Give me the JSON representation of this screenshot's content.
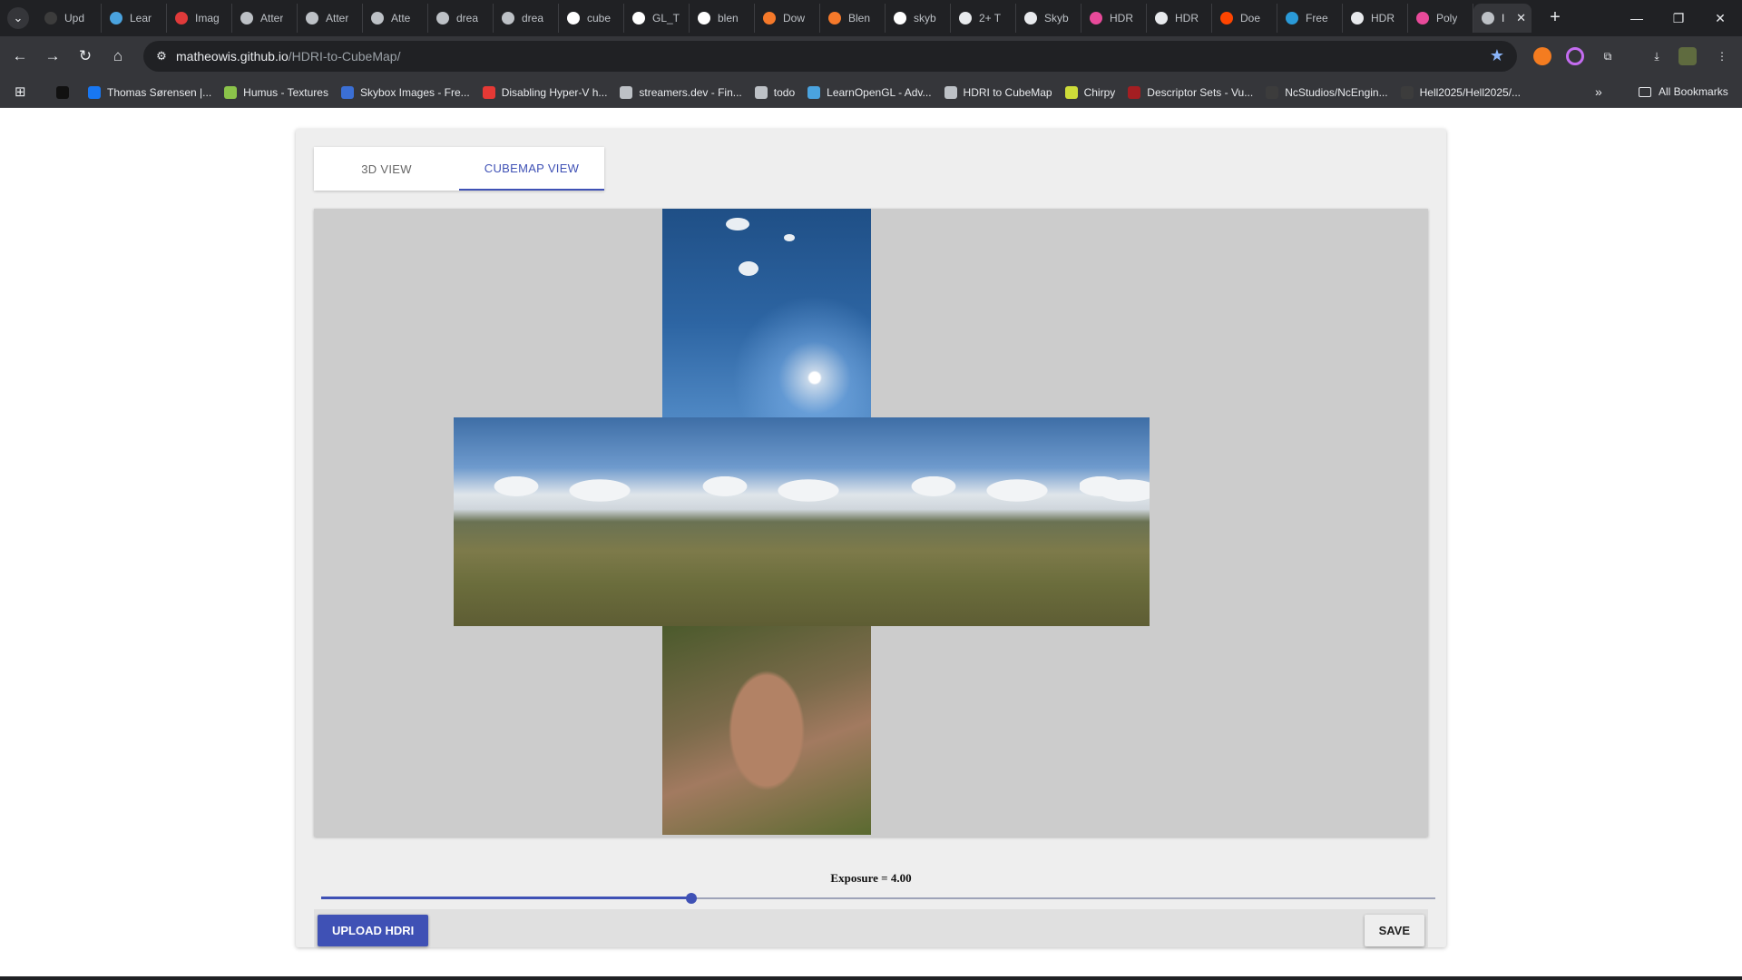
{
  "browser": {
    "tabs": [
      {
        "title": "Upd",
        "icon": "github-dark-icon",
        "color": "#3c3c3c"
      },
      {
        "title": "Lear",
        "icon": "learnopengl-icon",
        "color": "#4aa3df"
      },
      {
        "title": "Imag",
        "icon": "image-site-icon",
        "color": "#e03a3a"
      },
      {
        "title": "Atter",
        "icon": "globe-icon",
        "color": "#bdc1c6"
      },
      {
        "title": "Atter",
        "icon": "globe-icon",
        "color": "#bdc1c6"
      },
      {
        "title": "Atte",
        "icon": "globe-icon",
        "color": "#bdc1c6"
      },
      {
        "title": "drea",
        "icon": "globe-icon",
        "color": "#bdc1c6"
      },
      {
        "title": "drea",
        "icon": "globe-icon",
        "color": "#bdc1c6"
      },
      {
        "title": "cube",
        "icon": "google-icon",
        "color": "#ffffff"
      },
      {
        "title": "GL_T",
        "icon": "google-icon",
        "color": "#ffffff"
      },
      {
        "title": "blen",
        "icon": "google-icon",
        "color": "#ffffff"
      },
      {
        "title": "Dow",
        "icon": "blender-icon",
        "color": "#f5792a"
      },
      {
        "title": "Blen",
        "icon": "blender-icon",
        "color": "#f5792a"
      },
      {
        "title": "skyb",
        "icon": "google-icon",
        "color": "#ffffff"
      },
      {
        "title": "2+ T",
        "icon": "dollar-icon",
        "color": "#e8eaed"
      },
      {
        "title": "Skyb",
        "icon": "shield-icon",
        "color": "#e8eaed"
      },
      {
        "title": "HDR",
        "icon": "polyhaven-icon",
        "color": "#e84a9a"
      },
      {
        "title": "HDR",
        "icon": "document-icon",
        "color": "#e8eaed"
      },
      {
        "title": "Doe",
        "icon": "reddit-icon",
        "color": "#ff4500"
      },
      {
        "title": "Free",
        "icon": "arrow-site-icon",
        "color": "#2a9ad8"
      },
      {
        "title": "HDR",
        "icon": "github-icon",
        "color": "#e8eaed"
      },
      {
        "title": "Poly",
        "icon": "polyhaven-icon",
        "color": "#e84a9a"
      }
    ],
    "active_tab": {
      "title": "I",
      "icon": "globe-icon"
    },
    "url_host": "matheowis.github.io",
    "url_path": "/HDRI-to-CubeMap/",
    "bookmarks": [
      {
        "label": "",
        "icon": "cpp-site-icon",
        "color": "#111111"
      },
      {
        "label": "Thomas Sørensen |...",
        "icon": "facebook-icon",
        "color": "#1877f2"
      },
      {
        "label": "Humus - Textures",
        "icon": "humus-icon",
        "color": "#8bc34a"
      },
      {
        "label": "Skybox Images - Fre...",
        "icon": "skybox-site-icon",
        "color": "#3b6fd4"
      },
      {
        "label": "Disabling Hyper-V h...",
        "icon": "bookmark-red-icon",
        "color": "#e53935"
      },
      {
        "label": "streamers.dev - Fin...",
        "icon": "streamers-icon",
        "color": "#bdc1c6"
      },
      {
        "label": "todo",
        "icon": "globe-icon",
        "color": "#bdc1c6"
      },
      {
        "label": "LearnOpenGL - Adv...",
        "icon": "learnopengl-icon",
        "color": "#4aa3df"
      },
      {
        "label": "HDRI to CubeMap",
        "icon": "globe-icon",
        "color": "#bdc1c6"
      },
      {
        "label": "Chirpy",
        "icon": "chirpy-icon",
        "color": "#cddc39"
      },
      {
        "label": "Descriptor Sets - Vu...",
        "icon": "vulkan-icon",
        "color": "#a41e22"
      },
      {
        "label": "NcStudios/NcEngin...",
        "icon": "github-dark-icon",
        "color": "#3c3c3c"
      },
      {
        "label": "Hell2025/Hell2025/...",
        "icon": "github-dark-icon",
        "color": "#3c3c3c"
      }
    ],
    "all_bookmarks_label": "All Bookmarks"
  },
  "app": {
    "tabs": [
      {
        "label": "3D VIEW",
        "selected": false
      },
      {
        "label": "CUBEMAP VIEW",
        "selected": true
      }
    ],
    "exposure_label": "Exposure = 4.00",
    "exposure_value": 4.0,
    "slider_fraction": 0.332,
    "upload_label": "UPLOAD HDRI",
    "save_label": "SAVE",
    "accent_color": "#3f51b5",
    "cubemap_faces": [
      "top",
      "left",
      "front",
      "right",
      "back",
      "bottom"
    ]
  }
}
